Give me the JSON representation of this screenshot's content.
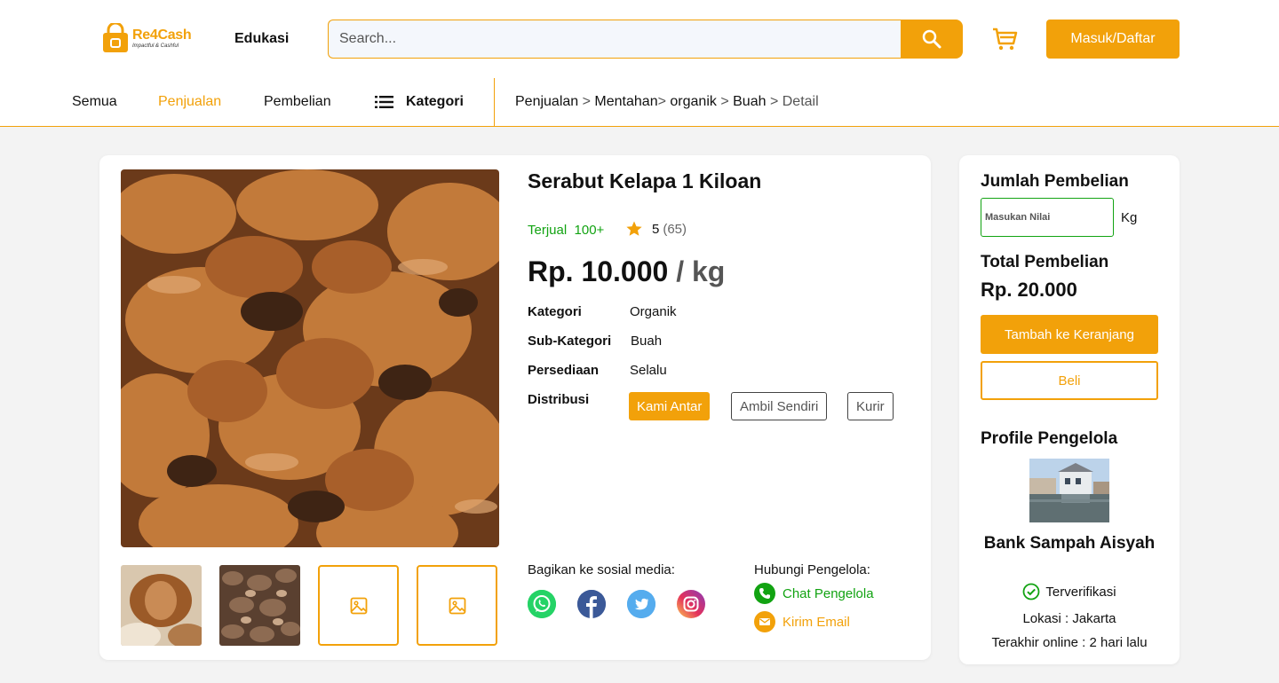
{
  "header": {
    "logo_name": "Re4Cash",
    "logo_tagline": "Impactful & Cashful",
    "nav_edukasi": "Edukasi",
    "search_placeholder": "Search...",
    "login_label": "Masuk/Daftar"
  },
  "subnav": {
    "items": [
      "Semua",
      "Penjualan",
      "Pembelian"
    ],
    "active": "Penjualan",
    "kategori_label": "Kategori"
  },
  "breadcrumb": [
    "Penjualan",
    "Mentahan",
    "organik",
    "Buah",
    "Detail"
  ],
  "product": {
    "title": "Serabut Kelapa 1 Kiloan",
    "sold_label": "Terjual",
    "sold_value": "100+",
    "rating": "5",
    "rating_count": "(65)",
    "price": "Rp. 10.000",
    "price_unit": "/ kg",
    "specs": [
      {
        "label": "Kategori",
        "value": "Organik"
      },
      {
        "label": "Sub-Kategori",
        "value": "Buah"
      },
      {
        "label": "Persediaan",
        "value": "Selalu"
      },
      {
        "label": "Distribusi",
        "value": ""
      }
    ],
    "distribution_options": [
      "Kami Antar",
      "Ambil Sendiri",
      "Kurir"
    ],
    "distribution_selected": "Kami Antar"
  },
  "share": {
    "label": "Bagikan ke sosial media:",
    "icons": [
      "whatsapp-icon",
      "facebook-icon",
      "twitter-icon",
      "instagram-icon"
    ]
  },
  "contact": {
    "label": "Hubungi Pengelola:",
    "chat_label": "Chat Pengelola",
    "email_label": "Kirim Email"
  },
  "purchase": {
    "qty_heading": "Jumlah Pembelian",
    "qty_placeholder": "Masukan Nilai",
    "qty_unit": "Kg",
    "total_heading": "Total Pembelian",
    "total_value": "Rp. 20.000",
    "add_to_cart_label": "Tambah ke Keranjang",
    "buy_label": "Beli"
  },
  "profile": {
    "heading": "Profile Pengelola",
    "name": "Bank Sampah Aisyah",
    "verified_label": "Terverifikasi",
    "location": "Lokasi : Jakarta",
    "last_online": "Terakhir online : 2 hari lalu"
  },
  "colors": {
    "accent": "#F2A10A",
    "success": "#12a312",
    "facebook": "#3b5998",
    "twitter": "#55acee",
    "whatsapp": "#25D366"
  }
}
